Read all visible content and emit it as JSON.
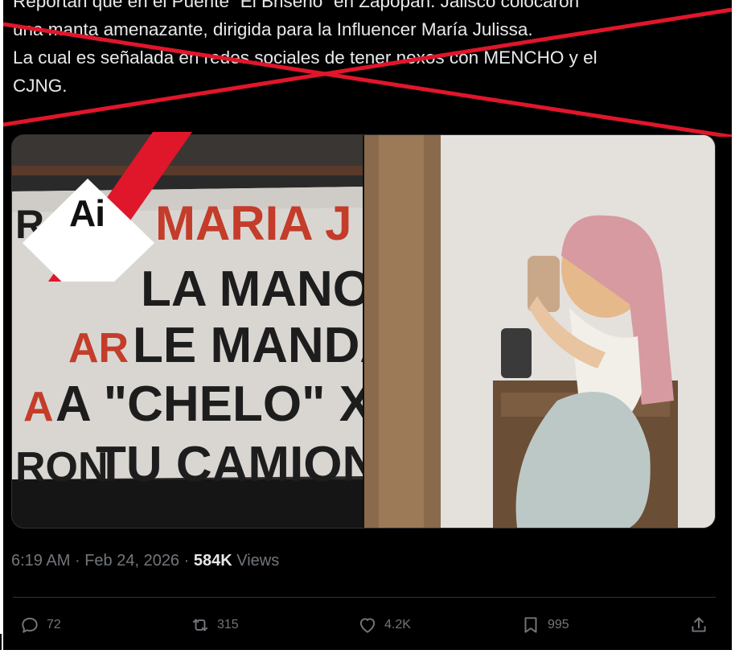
{
  "tweet": {
    "lines": [
      "Reportan que en el Puente “El Briseño” en Zapopan. Jalisco colocaron",
      "una manta amenazante, dirigida para la Influencer María Julissa.",
      "La cual es señalada en redes sociales de tener nexos con MENCHO y el",
      "CJNG."
    ]
  },
  "media": {
    "banner_lines": [
      "MARIA J",
      "LA MANO",
      "LE MANDA",
      "A \"CHELO\" XQ",
      "TU CAMION"
    ],
    "banner_fragments": [
      "R",
      "AR",
      "A",
      "RON"
    ],
    "ai_badge": "Ai"
  },
  "meta": {
    "time": "6:19 AM",
    "separator": "·",
    "date": "Feb 24, 2026",
    "views_count": "584K",
    "views_label": "Views"
  },
  "actions": {
    "reply": {
      "icon": "reply-icon",
      "count": "72"
    },
    "repost": {
      "icon": "repost-icon",
      "count": "315"
    },
    "like": {
      "icon": "heart-icon",
      "count": "4.2K"
    },
    "bookmark": {
      "icon": "bookmark-icon",
      "count": "995"
    },
    "share": {
      "icon": "share-icon"
    }
  },
  "colors": {
    "background": "#000000",
    "text": "#e7e9ea",
    "muted": "#71767b",
    "cross": "#e0162b",
    "badge": "#ffffff"
  }
}
